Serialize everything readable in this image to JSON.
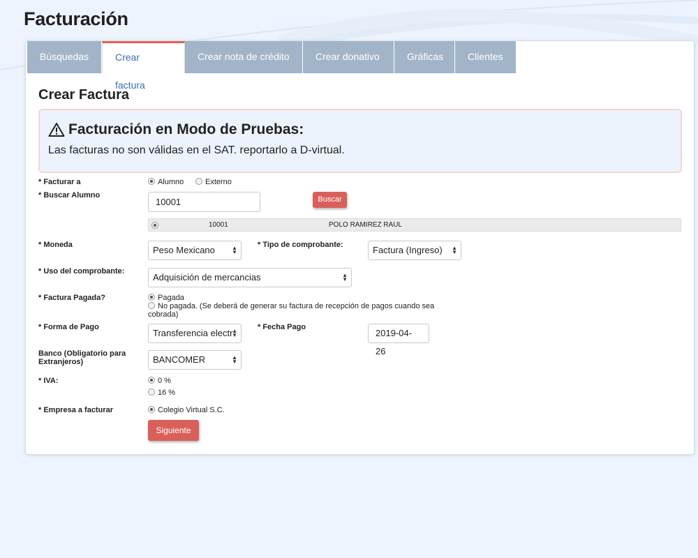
{
  "page": {
    "title": "Facturación"
  },
  "tabs": [
    {
      "label": "Búsquedas"
    },
    {
      "label": "Crear factura",
      "active": true
    },
    {
      "label": "Crear nota de crédito"
    },
    {
      "label": "Crear donativo"
    },
    {
      "label": "Gráficas"
    },
    {
      "label": "Clientes"
    }
  ],
  "section": {
    "title": "Crear Factura"
  },
  "alert": {
    "title": "Facturación en Modo de Pruebas:",
    "text": "Las facturas no son válidas en el SAT. reportarlo a D-virtual."
  },
  "form": {
    "facturar_a": {
      "label": "* Facturar a",
      "options": [
        "Alumno",
        "Externo"
      ],
      "selected": "Alumno"
    },
    "buscar_alumno": {
      "label": "* Buscar Alumno",
      "value": "10001",
      "button": "Buscar"
    },
    "result": {
      "id": "10001",
      "name": "POLO RAMIREZ RAUL"
    },
    "moneda": {
      "label": "* Moneda",
      "value": "Peso Mexicano"
    },
    "tipo_comprobante": {
      "label": "* Tipo de comprobante:",
      "value": "Factura (Ingreso)"
    },
    "uso_comprobante": {
      "label": "* Uso del comprobante:",
      "value": "Adquisición de mercancias"
    },
    "factura_pagada": {
      "label": "* Factura Pagada?",
      "options": [
        "Pagada",
        "No pagada. (Se deberá de generar su factura de recepción de pagos cuando sea cobrada)"
      ],
      "selected": "Pagada"
    },
    "forma_pago": {
      "label": "* Forma de Pago",
      "value": "Transferencia electr"
    },
    "fecha_pago": {
      "label": "* Fecha Pago",
      "value": "2019-04-26"
    },
    "banco": {
      "label": "Banco (Obligatorio para Extranjeros)",
      "value": "BANCOMER"
    },
    "iva": {
      "label": "* IVA:",
      "options": [
        "0 %",
        "16 %"
      ],
      "selected": "0 %"
    },
    "empresa": {
      "label": "* Empresa a facturar",
      "options": [
        "Colegio Virtual S.C."
      ],
      "selected": "Colegio Virtual S.C."
    },
    "submit": "Siguiente"
  },
  "colors": {
    "accent": "#d9605a",
    "tab_bg": "#a2b4c8",
    "active_tab_text": "#3a6fb0",
    "alert_bg": "#edf3fd"
  },
  "icons": {
    "alert": "warning-icon",
    "select": "chevron-updown-icon"
  }
}
